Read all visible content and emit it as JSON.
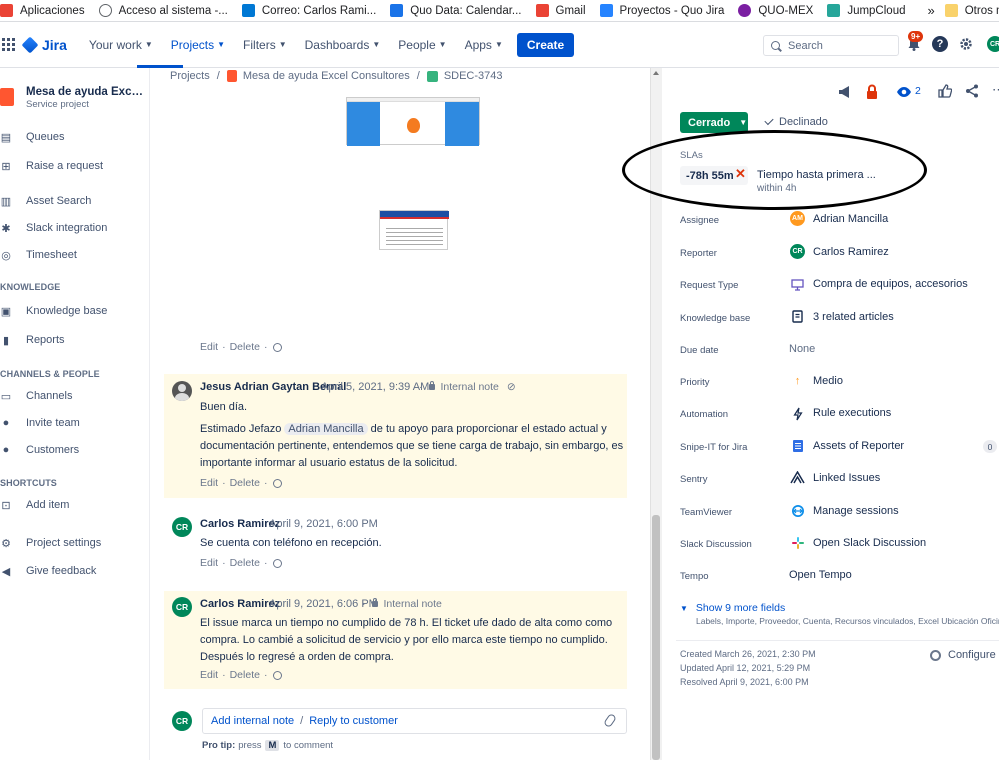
{
  "bookmarks": [
    {
      "label": "Aplicaciones",
      "color": "#ea4335"
    },
    {
      "label": "Acceso al sistema -...",
      "color": "#5f6368"
    },
    {
      "label": "Correo: Carlos Rami...",
      "color": "#0078d4"
    },
    {
      "label": "Quo Data: Calendar...",
      "color": "#1a73e8"
    },
    {
      "label": "Gmail",
      "color": "#ea4335"
    },
    {
      "label": "Proyectos - Quo Jira",
      "color": "#2684ff"
    },
    {
      "label": "QUO-MEX",
      "color": "#7b1fa2"
    },
    {
      "label": "JumpCloud",
      "color": "#26a69a"
    }
  ],
  "bookmarks_more": "»",
  "bookmarks_other": "Otros marcadores",
  "topnav": {
    "logo": "Jira",
    "items": [
      "Your work",
      "Projects",
      "Filters",
      "Dashboards",
      "People",
      "Apps"
    ],
    "create": "Create",
    "search_placeholder": "Search",
    "notifications_badge": "9+",
    "avatar_initials": "CR"
  },
  "sidebar": {
    "project_name": "Mesa de ayuda Excel Co...",
    "project_type": "Service project",
    "items_a": [
      "Queues",
      "Raise a request"
    ],
    "items_b": [
      "Asset Search",
      "Slack integration",
      "Timesheet"
    ],
    "knowledge_head": "KNOWLEDGE",
    "knowledge_items": [
      "Knowledge base",
      "Reports"
    ],
    "channels_head": "CHANNELS & PEOPLE",
    "channels_items": [
      "Channels",
      "Invite team",
      "Customers"
    ],
    "shortcuts_head": "SHORTCUTS",
    "shortcuts_items": [
      "Add item"
    ],
    "bottom_items": [
      "Project settings",
      "Give feedback"
    ]
  },
  "breadcrumb": {
    "root": "Projects",
    "project": "Mesa de ayuda Excel Consultores",
    "issue": "SDEC-3743"
  },
  "actions": {
    "edit": "Edit",
    "delete": "Delete",
    "dot": "·"
  },
  "comments": [
    {
      "author": "Jesus Adrian Gaytan Bernal",
      "date": "April 5, 2021, 9:39 AM",
      "note": "Internal note",
      "p1": "Buen día.",
      "p2_pre": "Estimado Jefazo",
      "p2_mention": "Adrian Mancilla",
      "p2_post": "de tu apoyo para proporcionar el estado actual y documentación pertinente, entendemos que se tiene carga de trabajo, sin embargo, es importante informar al usuario estatus de la solicitud."
    },
    {
      "author": "Carlos Ramirez",
      "date": "April 9, 2021, 6:00 PM",
      "initials": "CR",
      "text": "Se cuenta con teléfono en recepción."
    },
    {
      "author": "Carlos Ramirez",
      "date": "April 9, 2021, 6:06 PM",
      "initials": "CR",
      "note": "Internal note",
      "text": "El issue marca un tiempo no cumplido de 78 h.  El ticket ufe dado de alta como como compra. Lo cambié a solicitud de servicio y por ello marca este tiempo no cumplido. Después lo regresé a orden de compra."
    }
  ],
  "reply": {
    "initials": "CR",
    "internal": "Add internal note",
    "sep": "/",
    "customer": "Reply to customer",
    "protip_label": "Pro tip:",
    "protip_pre": "press",
    "protip_key": "M",
    "protip_post": "to comment"
  },
  "right": {
    "watchers": "2",
    "status": "Cerrado",
    "resolution": "Declinado",
    "sla_label": "SLAs",
    "sla_time": "-78h 55m",
    "sla_name": "Tiempo hasta primera ...",
    "sla_target": "within 4h",
    "fields": [
      {
        "label": "Assignee",
        "value": "Adrian Mancilla",
        "icon": "avatar-am"
      },
      {
        "label": "Reporter",
        "value": "Carlos Ramirez",
        "icon": "avatar-cr"
      },
      {
        "label": "Request Type",
        "value": "Compra de equipos, accesorios",
        "icon": "monitor-icon"
      },
      {
        "label": "Knowledge base",
        "value": "3 related articles",
        "icon": "book-icon"
      },
      {
        "label": "Due date",
        "value": "None",
        "icon": ""
      },
      {
        "label": "Priority",
        "value": "Medio",
        "icon": "arrow-up-icon"
      },
      {
        "label": "Automation",
        "value": "Rule executions",
        "icon": "bolt-icon"
      },
      {
        "label": "Snipe-IT for Jira",
        "value": "Assets of Reporter",
        "icon": "list-icon"
      },
      {
        "label": "Sentry",
        "value": "Linked Issues",
        "icon": "sentry-icon"
      },
      {
        "label": "TeamViewer",
        "value": "Manage sessions",
        "icon": "teamviewer-icon"
      },
      {
        "label": "Slack Discussion",
        "value": "Open Slack Discussion",
        "icon": "slack-icon"
      },
      {
        "label": "Tempo",
        "value": "Open Tempo",
        "icon": ""
      }
    ],
    "assets_count": "0",
    "more_fields": "Show 9 more fields",
    "more_list": "Labels, Importe, Proveedor, Cuenta, Recursos vinculados, Excel Ubicación Oficina, Ti...",
    "created": "Created March 26, 2021, 2:30 PM",
    "updated": "Updated April 12, 2021, 5:29 PM",
    "resolved": "Resolved April 9, 2021, 6:00 PM",
    "configure": "Configure"
  }
}
